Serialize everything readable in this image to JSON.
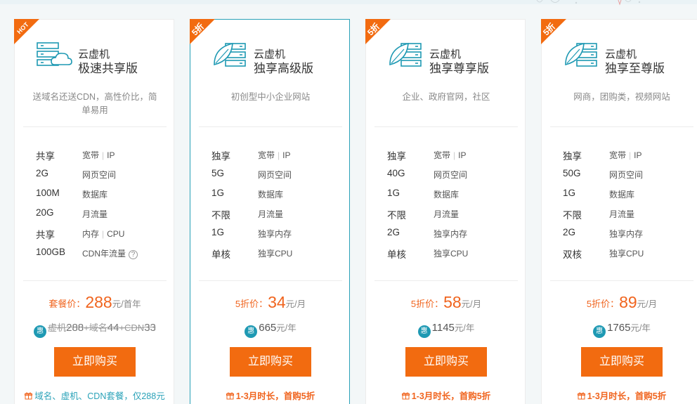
{
  "colors": {
    "accent": "#2aa2b8",
    "orange": "#f26b10",
    "price": "#f0641e",
    "hui_badge": "#1e99b3"
  },
  "cards": [
    {
      "ribbon": "HOT",
      "product": "云虚机",
      "edition": "极速共享版",
      "desc": "送域名还送CDN，高性价比，简单易用",
      "specs": [
        {
          "value": "共享",
          "labels": [
            "宽带",
            "IP"
          ]
        },
        {
          "value": "2G",
          "labels": [
            "网页空间"
          ]
        },
        {
          "value": "100M",
          "labels": [
            "数据库"
          ]
        },
        {
          "value": "20G",
          "labels": [
            "月流量"
          ]
        },
        {
          "value": "共享",
          "labels": [
            "内存",
            "CPU"
          ]
        },
        {
          "value": "100GB",
          "labels": [
            "CDN年流量"
          ],
          "help": "?"
        }
      ],
      "price_label": "套餐价：",
      "price_value": "288",
      "price_unit": "元/首年",
      "hui": "惠",
      "orig_parts": [
        "虚机",
        "288",
        "+域名",
        "44",
        "+CDN",
        "33"
      ],
      "buy_label": "立即购买",
      "promo": "域名、虚机、CDN套餐，仅288元"
    },
    {
      "ribbon": "5折",
      "product": "云虚机",
      "edition": "独享高级版",
      "desc": "初创型中小企业网站",
      "specs": [
        {
          "value": "独享",
          "labels": [
            "宽带",
            "IP"
          ]
        },
        {
          "value": "5G",
          "labels": [
            "网页空间"
          ]
        },
        {
          "value": "1G",
          "labels": [
            "数据库"
          ]
        },
        {
          "value": "不限",
          "labels": [
            "月流量"
          ]
        },
        {
          "value": "1G",
          "labels": [
            "独享内存"
          ]
        },
        {
          "value": "单核",
          "labels": [
            "独享CPU"
          ]
        }
      ],
      "price_label": "5折价：",
      "price_value": "34",
      "price_unit": "元/月",
      "hui": "惠",
      "year_value": "665",
      "year_unit": "元/年",
      "buy_label": "立即购买",
      "promo": "1-3月时长，首购5折"
    },
    {
      "ribbon": "5折",
      "product": "云虚机",
      "edition": "独享尊享版",
      "desc": "企业、政府官网，社区",
      "specs": [
        {
          "value": "独享",
          "labels": [
            "宽带",
            "IP"
          ]
        },
        {
          "value": "40G",
          "labels": [
            "网页空间"
          ]
        },
        {
          "value": "1G",
          "labels": [
            "数据库"
          ]
        },
        {
          "value": "不限",
          "labels": [
            "月流量"
          ]
        },
        {
          "value": "2G",
          "labels": [
            "独享内存"
          ]
        },
        {
          "value": "单核",
          "labels": [
            "独享CPU"
          ]
        }
      ],
      "price_label": "5折价：",
      "price_value": "58",
      "price_unit": "元/月",
      "hui": "惠",
      "year_value": "1145",
      "year_unit": "元/年",
      "buy_label": "立即购买",
      "promo": "1-3月时长，首购5折"
    },
    {
      "ribbon": "5折",
      "product": "云虚机",
      "edition": "独享至尊版",
      "desc": "网商，团购类，视频网站",
      "specs": [
        {
          "value": "独享",
          "labels": [
            "宽带",
            "IP"
          ]
        },
        {
          "value": "50G",
          "labels": [
            "网页空间"
          ]
        },
        {
          "value": "1G",
          "labels": [
            "数据库"
          ]
        },
        {
          "value": "不限",
          "labels": [
            "月流量"
          ]
        },
        {
          "value": "2G",
          "labels": [
            "独享内存"
          ]
        },
        {
          "value": "双核",
          "labels": [
            "独享CPU"
          ]
        }
      ],
      "price_label": "5折价：",
      "price_value": "89",
      "price_unit": "元/月",
      "hui": "惠",
      "year_value": "1765",
      "year_unit": "元/年",
      "buy_label": "立即购买",
      "promo": "1-3月时长，首购5折"
    }
  ]
}
